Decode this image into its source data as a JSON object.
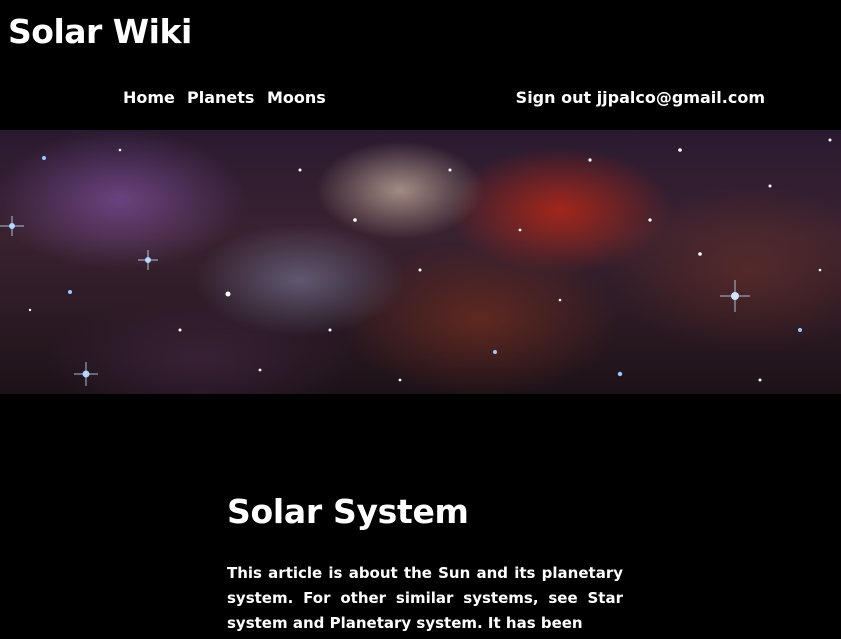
{
  "site": {
    "title": "Solar Wiki"
  },
  "nav": {
    "items": [
      {
        "label": "Home"
      },
      {
        "label": "Planets"
      },
      {
        "label": "Moons"
      }
    ],
    "signout_label": "Sign out jjpalco@gmail.com"
  },
  "banner": {
    "image": "nebula-starfield-image",
    "colors": {
      "background": "#000000",
      "nebula_red": "#c82814",
      "nebula_violet": "#8c5ab4",
      "star_blue": "#9cc8ff"
    }
  },
  "article": {
    "title": "Solar System",
    "intro": "This article is about the Sun and its planetary system. For other similar systems, see Star system and Planetary system. It has been"
  }
}
